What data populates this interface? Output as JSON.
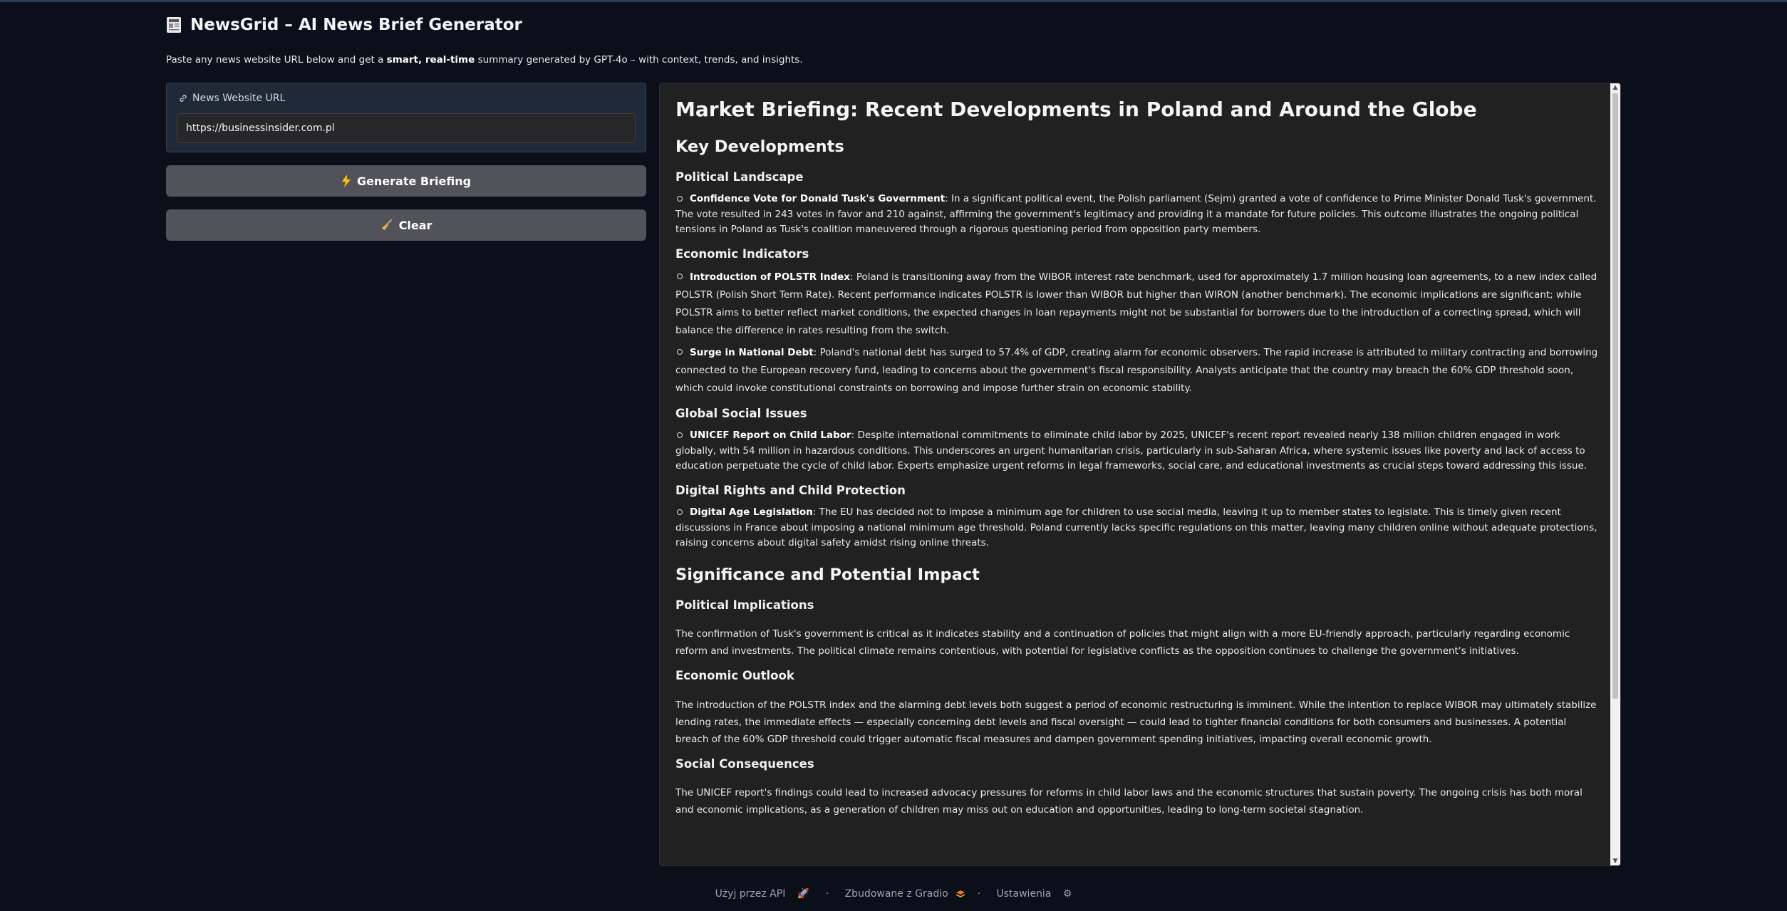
{
  "app": {
    "title": "NewsGrid – AI News Brief Generator",
    "subtitle_pre": "Paste any news website URL below and get a ",
    "subtitle_bold": "smart, real-time",
    "subtitle_post": " summary generated by GPT-4o – with context, trends, and insights."
  },
  "input": {
    "label": "News Website URL",
    "value": "https://businessinsider.com.pl"
  },
  "buttons": {
    "generate": "Generate Briefing",
    "clear": "Clear"
  },
  "briefing": {
    "title": "Market Briefing: Recent Developments in Poland and Around the Globe",
    "key_heading": "Key Developments",
    "political_heading": "Political Landscape",
    "political_item_bold": "Confidence Vote for Donald Tusk's Government",
    "political_item_text": ": In a significant political event, the Polish parliament (Sejm) granted a vote of confidence to Prime Minister Donald Tusk's government. The vote resulted in 243 votes in favor and 210 against, affirming the government's legitimacy and providing it a mandate for future policies. This outcome illustrates the ongoing political tensions in Poland as Tusk's coalition maneuvered through a rigorous questioning period from opposition party members.",
    "economic_heading": "Economic Indicators",
    "economic_item1_bold": "Introduction of POLSTR Index",
    "economic_item1_text": ": Poland is transitioning away from the WIBOR interest rate benchmark, used for approximately 1.7 million housing loan agreements, to a new index called POLSTR (Polish Short Term Rate). Recent performance indicates POLSTR is lower than WIBOR but higher than WIRON (another benchmark). The economic implications are significant; while POLSTR aims to better reflect market conditions, the expected changes in loan repayments might not be substantial for borrowers due to the introduction of a correcting spread, which will balance the difference in rates resulting from the switch.",
    "economic_item2_bold": "Surge in National Debt",
    "economic_item2_text": ": Poland's national debt has surged to 57.4% of GDP, creating alarm for economic observers. The rapid increase is attributed to military contracting and borrowing connected to the European recovery fund, leading to concerns about the government's fiscal responsibility. Analysts anticipate that the country may breach the 60% GDP threshold soon, which could invoke constitutional constraints on borrowing and impose further strain on economic stability.",
    "social_heading": "Global Social Issues",
    "social_item_bold": "UNICEF Report on Child Labor",
    "social_item_text": ": Despite international commitments to eliminate child labor by 2025, UNICEF's recent report revealed nearly 138 million children engaged in work globally, with 54 million in hazardous conditions. This underscores an urgent humanitarian crisis, particularly in sub-Saharan Africa, where systemic issues like poverty and lack of access to education perpetuate the cycle of child labor. Experts emphasize urgent reforms in legal frameworks, social care, and educational investments as crucial steps toward addressing this issue.",
    "digital_heading": "Digital Rights and Child Protection",
    "digital_item_bold": "Digital Age Legislation",
    "digital_item_text": ": The EU has decided not to impose a minimum age for children to use social media, leaving it up to member states to legislate. This is timely given recent discussions in France about imposing a national minimum age threshold. Poland currently lacks specific regulations on this matter, leaving many children online without adequate protections, raising concerns about digital safety amidst rising online threats.",
    "impact_heading": "Significance and Potential Impact",
    "polimp_heading": "Political Implications",
    "polimp_text": "The confirmation of Tusk's government is critical as it indicates stability and a continuation of policies that might align with a more EU-friendly approach, particularly regarding economic reform and investments. The political climate remains contentious, with potential for legislative conflicts as the opposition continues to challenge the government's initiatives.",
    "econ_outlook_heading": "Economic Outlook",
    "econ_outlook_text": "The introduction of the POLSTR index and the alarming debt levels both suggest a period of economic restructuring is imminent. While the intention to replace WIBOR may ultimately stabilize lending rates, the immediate effects — especially concerning debt levels and fiscal oversight — could lead to tighter financial conditions for both consumers and businesses. A potential breach of the 60% GDP threshold could trigger automatic fiscal measures and dampen government spending initiatives, impacting overall economic growth.",
    "social_cons_heading": "Social Consequences",
    "social_cons_text": "The UNICEF report's findings could lead to increased advocacy pressures for reforms in child labor laws and the economic structures that sustain poverty. The ongoing crisis has both moral and economic implications, as a generation of children may miss out on education and opportunities, leading to long-term societal stagnation."
  },
  "footer": {
    "api": "Użyj przez API",
    "built": "Zbudowane z Gradio",
    "settings": "Ustawienia",
    "sep": "·"
  },
  "icons": {
    "title_icon": "newspaper-icon",
    "link_icon": "link-icon",
    "generate_icon": "lightning-icon",
    "clear_icon": "broom-icon",
    "api_icon": "rocket-icon",
    "gradio_icon": "gradio-logo-icon",
    "settings_icon": "gear-icon"
  }
}
